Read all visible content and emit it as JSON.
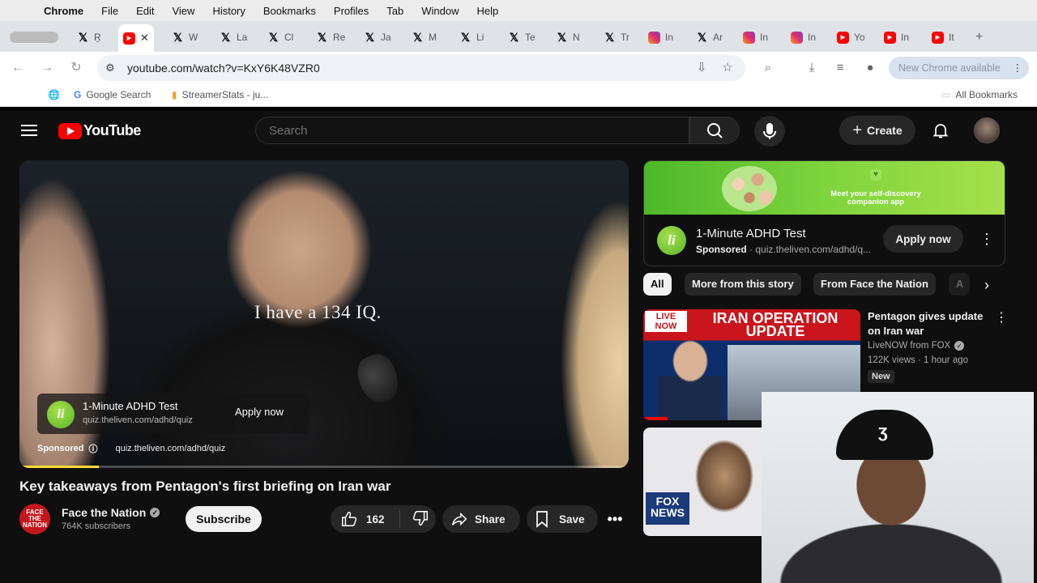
{
  "menubar": {
    "app": "Chrome",
    "items": [
      "File",
      "Edit",
      "View",
      "History",
      "Bookmarks",
      "Profiles",
      "Tab",
      "Window",
      "Help"
    ]
  },
  "tabs": [
    {
      "icon": "x-icon",
      "label": "Ṟ"
    },
    {
      "icon": "youtube-icon",
      "label": ""
    },
    {
      "icon": "x-icon",
      "label": "W"
    },
    {
      "icon": "x-icon",
      "label": "La"
    },
    {
      "icon": "x-icon",
      "label": "Cl"
    },
    {
      "icon": "x-icon",
      "label": "Re"
    },
    {
      "icon": "x-icon",
      "label": "Ja"
    },
    {
      "icon": "x-icon",
      "label": "M"
    },
    {
      "icon": "x-icon",
      "label": "Li"
    },
    {
      "icon": "x-icon",
      "label": "Te"
    },
    {
      "icon": "x-icon",
      "label": "N"
    },
    {
      "icon": "x-icon",
      "label": "Tr"
    },
    {
      "icon": "instagram-icon",
      "label": "In"
    },
    {
      "icon": "x-icon",
      "label": "Ar"
    },
    {
      "icon": "instagram-icon",
      "label": "In"
    },
    {
      "icon": "instagram-icon",
      "label": "In"
    },
    {
      "icon": "youtube-icon",
      "label": "Yo"
    },
    {
      "icon": "youtube-icon",
      "label": "In"
    },
    {
      "icon": "youtube-icon",
      "label": "It"
    }
  ],
  "toolbar": {
    "url": "youtube.com/watch?v=KxY6K48VZR0",
    "update_label": "New Chrome available"
  },
  "bookmarks": {
    "items": [
      "Google Search",
      "StreamerStats - ju..."
    ],
    "all_label": "All Bookmarks"
  },
  "youtube": {
    "logo_text": "YouTube",
    "search_placeholder": "Search",
    "create_label": "Create",
    "video": {
      "overlay_text": "I have a 134 IQ.",
      "ad_title": "1-Minute ADHD Test",
      "ad_url": "quiz.theliven.com/adhd/quiz",
      "ad_apply": "Apply now",
      "sponsored_label": "Sponsored",
      "sponsored_url": "quiz.theliven.com/adhd/quiz",
      "progress": 0.13
    },
    "title": "Key takeaways from Pentagon's first briefing on Iran war",
    "channel": {
      "avatar_text": "FACE THE NATION",
      "name": "Face the Nation",
      "subscribers": "764K subscribers",
      "subscribe_label": "Subscribe"
    },
    "actions": {
      "likes": "162",
      "share": "Share",
      "save": "Save"
    },
    "sidebar_ad": {
      "tagline": "Meet your self-discovery companion app",
      "title": "1-Minute ADHD Test",
      "sponsored": "Sponsored",
      "url": "quiz.theliven.com/adhd/q...",
      "apply": "Apply now"
    },
    "chips": [
      "All",
      "More from this story",
      "From Face the Nation",
      "A"
    ],
    "recommended": [
      {
        "thumb_live": "LIVE NOW",
        "thumb_headline": "IRAN OPERATION UPDATE",
        "title": "Pentagon gives update on Iran war",
        "channel": "LiveNOW from FOX",
        "meta": "122K views · 1 hour ago",
        "badge": "New"
      },
      {
        "thumb_logo": "FOX NEWS"
      }
    ]
  }
}
